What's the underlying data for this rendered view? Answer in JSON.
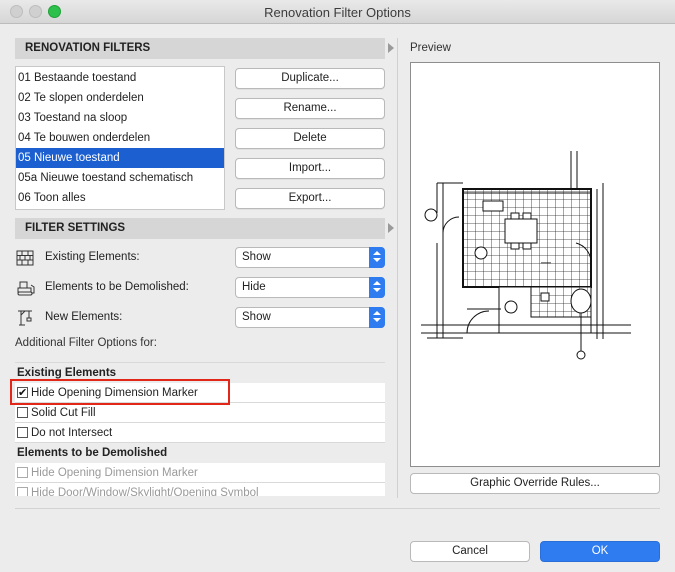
{
  "window": {
    "title": "Renovation Filter Options"
  },
  "renovation_filters": {
    "header": "RENOVATION FILTERS",
    "items": [
      "01 Bestaande toestand",
      "02 Te slopen onderdelen",
      "03 Toestand na sloop",
      "04 Te bouwen onderdelen",
      "05 Nieuwe toestand",
      "05a Nieuwe toestand schematisch",
      "06 Toon alles"
    ],
    "selected": "05 Nieuwe toestand"
  },
  "actions": {
    "duplicate": "Duplicate...",
    "rename": "Rename...",
    "delete": "Delete",
    "import": "Import...",
    "export": "Export..."
  },
  "filter_settings": {
    "header": "FILTER SETTINGS",
    "existing": {
      "label": "Existing Elements:",
      "value": "Show",
      "icon": "brick-wall-icon"
    },
    "demolished": {
      "label": "Elements to be Demolished:",
      "value": "Hide",
      "icon": "bulldozer-icon"
    },
    "new": {
      "label": "New Elements:",
      "value": "Show",
      "icon": "crane-icon"
    }
  },
  "additional": {
    "label": "Additional Filter Options for:",
    "groups": [
      {
        "title": "Existing Elements",
        "options": [
          {
            "label": "Hide Opening Dimension Marker",
            "checked": true
          },
          {
            "label": "Solid Cut Fill",
            "checked": false
          },
          {
            "label": "Do not Intersect",
            "checked": false
          }
        ]
      },
      {
        "title": "Elements to be Demolished",
        "options": [
          {
            "label": "Hide Opening Dimension Marker",
            "checked": false
          },
          {
            "label": "Hide Door/Window/Skylight/Opening Symbol",
            "checked": false
          }
        ]
      }
    ]
  },
  "preview": {
    "label": "Preview"
  },
  "footer": {
    "graphic_override": "Graphic Override Rules...",
    "cancel": "Cancel",
    "ok": "OK"
  },
  "colors": {
    "accent": "#2f7bf0",
    "selection": "#1b5fd0",
    "highlight": "#e2261a",
    "maximize": "#2dc04a"
  }
}
